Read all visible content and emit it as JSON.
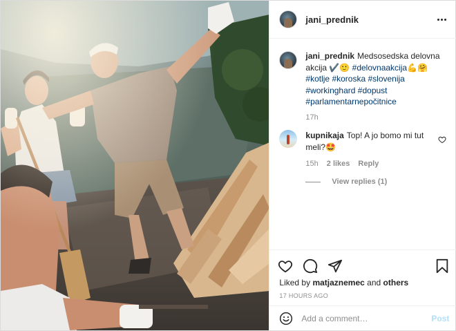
{
  "post": {
    "username": "jani_prednik",
    "caption": {
      "text": "Medsosedska delovna akcija ✔️🙂",
      "hashtags": [
        "#delovnaakcija💪🤗",
        "#kotlje",
        "#koroska",
        "#slovenija",
        "#workinghard",
        "#dopust",
        "#parlamentarnepočitnice"
      ],
      "time": "17h"
    },
    "comments": [
      {
        "username": "kupnikaja",
        "text": "Top! A jo bomo mi tut meli?🤩",
        "time": "15h",
        "likes": "2 likes",
        "reply_label": "Reply",
        "view_replies": "View replies (1)"
      }
    ],
    "liked_by_prefix": "Liked by",
    "liked_by_user": "matjaznemec",
    "liked_by_and": "and",
    "liked_by_others": "others",
    "timestamp": "17 HOURS AGO",
    "add_comment_placeholder": "Add a comment…",
    "post_button": "Post"
  },
  "icons": {
    "more": "more-options-icon",
    "like": "heart-icon",
    "comment": "comment-icon",
    "share": "share-icon",
    "save": "bookmark-icon",
    "emoji": "emoji-icon"
  },
  "colors": {
    "link": "#00376b",
    "muted": "#8e8e8e",
    "post_disabled": "#b2dffc"
  }
}
